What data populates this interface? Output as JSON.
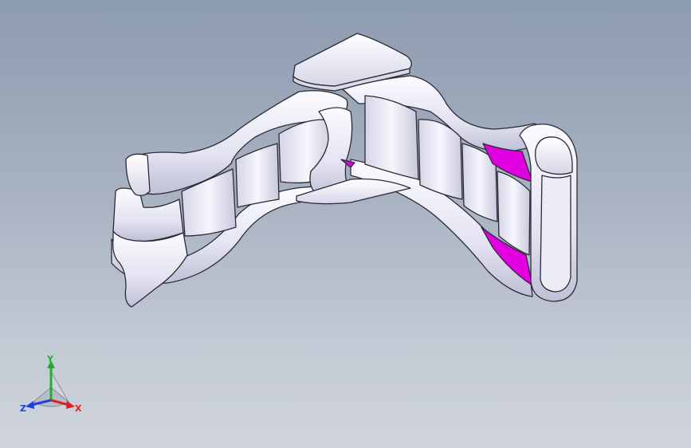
{
  "viewport": {
    "background_top": "#8d9bb0",
    "background_bottom": "#cfd4dc"
  },
  "model": {
    "body_color": "#f1f1f8",
    "edge_color": "#2b2b36",
    "shade_color": "#c9c9dc",
    "highlight_color": "#e000e0"
  },
  "triad": {
    "x_label": "X",
    "y_label": "Y",
    "z_label": "Z",
    "x_color": "#e02020",
    "y_color": "#20b030",
    "z_color": "#2040e0"
  }
}
